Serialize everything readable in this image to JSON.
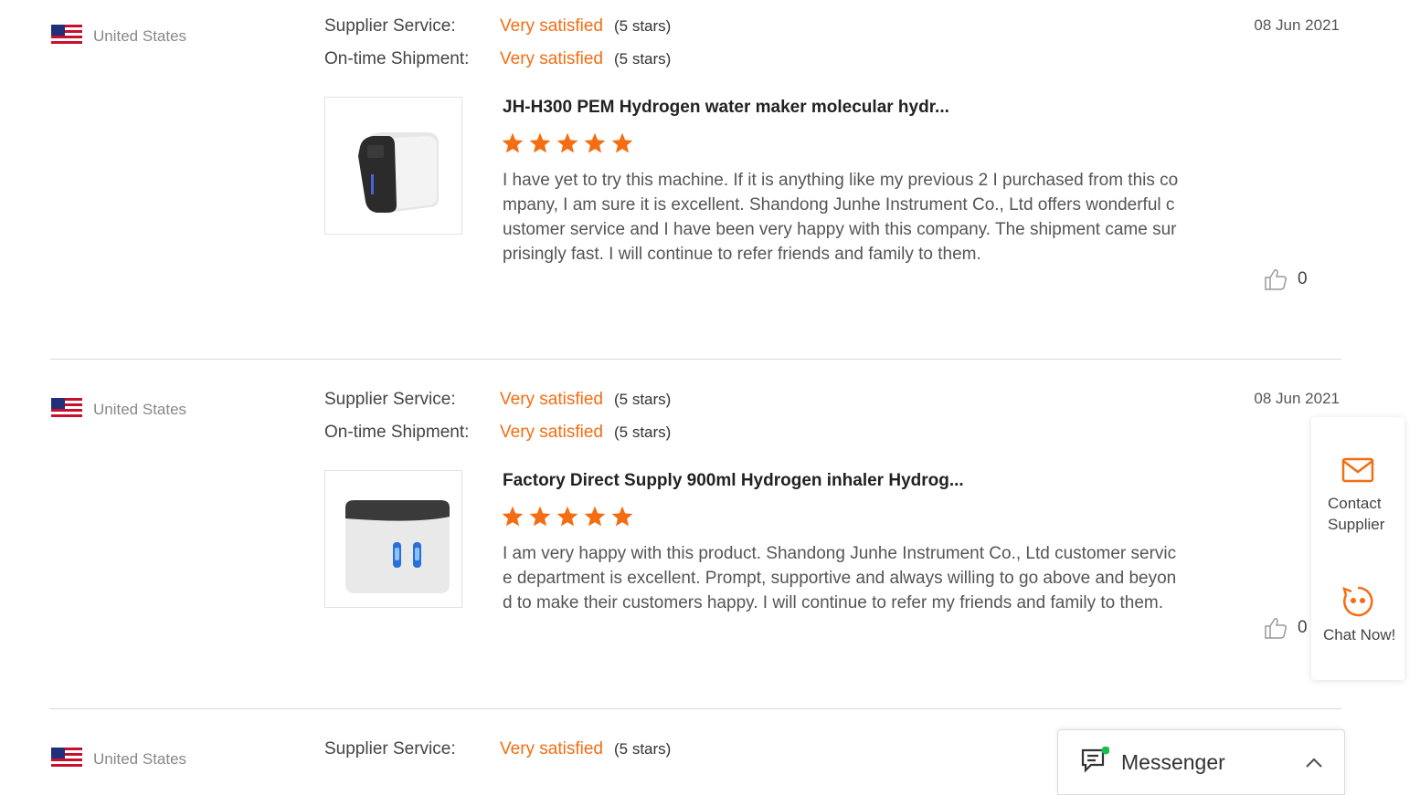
{
  "reviews": [
    {
      "country": "United States",
      "supplier_service_label": "Supplier Service:",
      "supplier_service_value": "Very satisfied",
      "supplier_service_stars": "(5 stars)",
      "shipment_label": "On-time Shipment:",
      "shipment_value": "Very satisfied",
      "shipment_stars": "(5 stars)",
      "date": "08 Jun 2021",
      "product_title": "JH-H300 PEM Hydrogen water maker molecular hydr...",
      "rating": 5,
      "text": "I have yet to try this machine. If it is anything like my previous 2 I purchased from this company,  I am sure it is excellent. Shandong Junhe Instrument Co., Ltd offers wonderful customer service and I have been very happy with this company. The shipment came surprisingly fast. I will continue to refer friends and family to them.",
      "likes": "0"
    },
    {
      "country": "United States",
      "supplier_service_label": "Supplier Service:",
      "supplier_service_value": "Very satisfied",
      "supplier_service_stars": "(5 stars)",
      "shipment_label": "On-time Shipment:",
      "shipment_value": "Very satisfied",
      "shipment_stars": "(5 stars)",
      "date": "08 Jun 2021",
      "product_title": "Factory Direct Supply 900ml Hydrogen inhaler Hydrog...",
      "rating": 5,
      "text": "I am very happy with this product. Shandong Junhe Instrument Co., Ltd customer service department is excellent. Prompt, supportive and always willing to go above and beyond to make their customers happy.  I will continue to refer my friends and family to them.",
      "likes": "0"
    },
    {
      "country": "United States",
      "supplier_service_label": "Supplier Service:",
      "supplier_service_value": "Very satisfied",
      "supplier_service_stars": "(5 stars)"
    }
  ],
  "side_panel": {
    "contact_label": "Contact Supplier",
    "chat_label": "Chat Now!"
  },
  "messenger": {
    "title": "Messenger"
  },
  "colors": {
    "accent": "#f46d12",
    "star": "#f46d12",
    "divider": "#d9d9d9"
  },
  "icons": [
    "us-flag-icon",
    "star-icon",
    "thumbs-up-icon",
    "mail-icon",
    "chat-face-icon",
    "message-icon",
    "chevron-up-icon"
  ]
}
